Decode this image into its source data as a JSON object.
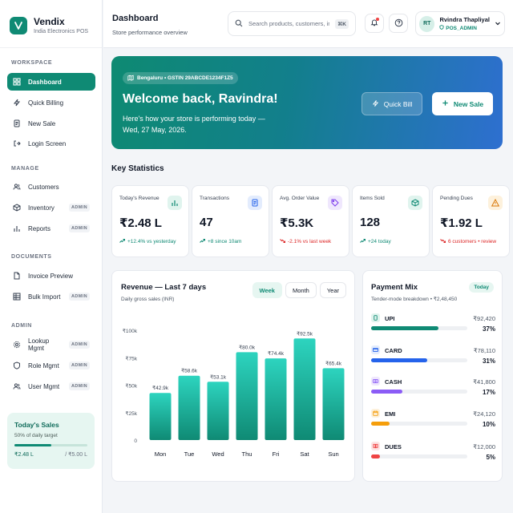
{
  "brand": {
    "name": "Vendix",
    "subtitle": "India Electronics POS"
  },
  "sidebar": {
    "sections": [
      {
        "label": "WORKSPACE",
        "items": [
          {
            "label": "Dashboard",
            "icon": "grid-icon",
            "active": true
          },
          {
            "label": "Quick Billing",
            "icon": "bolt-icon"
          },
          {
            "label": "New Sale",
            "icon": "receipt-icon"
          },
          {
            "label": "Login Screen",
            "icon": "login-icon"
          }
        ]
      },
      {
        "label": "MANAGE",
        "items": [
          {
            "label": "Customers",
            "icon": "users-icon"
          },
          {
            "label": "Inventory",
            "icon": "box-icon",
            "badge": "ADMIN"
          },
          {
            "label": "Reports",
            "icon": "bar-chart-icon",
            "badge": "ADMIN"
          }
        ]
      },
      {
        "label": "DOCUMENTS",
        "items": [
          {
            "label": "Invoice Preview",
            "icon": "file-icon"
          },
          {
            "label": "Bulk Import",
            "icon": "table-icon",
            "badge": "ADMIN"
          }
        ]
      },
      {
        "label": "ADMIN",
        "items": [
          {
            "label": "Lookup Mgmt",
            "icon": "gear-icon",
            "badge": "ADMIN"
          },
          {
            "label": "Role Mgmt",
            "icon": "shield-icon",
            "badge": "ADMIN"
          },
          {
            "label": "User Mgmt",
            "icon": "users-icon",
            "badge": "ADMIN"
          }
        ]
      }
    ],
    "sales_card": {
      "title": "Today's Sales",
      "subtitle": "50% of daily target",
      "progress": 0.5,
      "current": "₹2.48 L",
      "target": "/ ₹5.00 L"
    }
  },
  "header": {
    "title": "Dashboard",
    "subtitle": "Store performance overview",
    "search_placeholder": "Search products, customers, in",
    "shortcut": "⌘K",
    "user": {
      "initials": "RT",
      "name": "Rvindra Thapliyal",
      "role": "POS_ADMIN"
    }
  },
  "hero": {
    "pill": "Bengaluru • GSTIN 29ABCDE1234F1Z5",
    "title": "Welcome back, Ravindra!",
    "subtitle": "Here's how your store is performing today — Wed, 27 May, 2026.",
    "quick_bill": "Quick Bill",
    "new_sale": "New Sale"
  },
  "key_stats_title": "Key Statistics",
  "stats": [
    {
      "label": "Today's Revenue",
      "value": "₹2.48 L",
      "delta": "+12.4% vs yesterday",
      "trend": "up",
      "icon": "bar-chart-icon",
      "color": "#0f8a74",
      "bg": "#e0f4ee"
    },
    {
      "label": "Transactions",
      "value": "47",
      "delta": "+8 since 10am",
      "trend": "up",
      "icon": "receipt-icon",
      "color": "#2563eb",
      "bg": "#e3ecfd"
    },
    {
      "label": "Avg. Order Value",
      "value": "₹5.3K",
      "delta": "-2.1% vs last week",
      "trend": "down",
      "icon": "tag-icon",
      "color": "#7c3aed",
      "bg": "#efe7fd"
    },
    {
      "label": "Items Sold",
      "value": "128",
      "delta": "+24 today",
      "trend": "up",
      "icon": "box-icon",
      "color": "#0f8a74",
      "bg": "#e0f4ee"
    },
    {
      "label": "Pending Dues",
      "value": "₹1.92 L",
      "delta": "6 customers • review",
      "trend": "down",
      "icon": "warning-icon",
      "color": "#d97706",
      "bg": "#fdf1dc"
    }
  ],
  "revenue": {
    "title": "Revenue — Last 7 days",
    "subtitle": "Daily gross sales (INR)",
    "tabs": [
      "Week",
      "Month",
      "Year"
    ],
    "active_tab": "Week"
  },
  "chart_data": {
    "type": "bar",
    "title": "Revenue — Last 7 days",
    "categories": [
      "Mon",
      "Tue",
      "Wed",
      "Thu",
      "Fri",
      "Sat",
      "Sun"
    ],
    "values": [
      42.9,
      58.6,
      53.1,
      80.0,
      74.4,
      92.5,
      65.4
    ],
    "data_labels": [
      "₹42.9k",
      "₹58.6k",
      "₹53.1k",
      "₹80.0k",
      "₹74.4k",
      "₹92.5k",
      "₹65.4k"
    ],
    "y_ticks": [
      0,
      25,
      50,
      75,
      100
    ],
    "y_tick_labels": [
      "0",
      "₹25k",
      "₹50k",
      "₹75k",
      "₹100k"
    ],
    "ylim": [
      0,
      100
    ],
    "grid": false,
    "color": "#14b8a6"
  },
  "payment_mix": {
    "title": "Payment Mix",
    "badge": "Today",
    "subtitle": "Tender-mode breakdown • ₹2,48,450",
    "items": [
      {
        "name": "UPI",
        "amount": "₹92,420",
        "pct_label": "37%",
        "pct": 37,
        "color": "#0f8a74",
        "icon_bg": "#e0f4ee"
      },
      {
        "name": "CARD",
        "amount": "₹78,110",
        "pct_label": "31%",
        "pct": 31,
        "color": "#2563eb",
        "icon_bg": "#e3ecfd"
      },
      {
        "name": "CASH",
        "amount": "₹41,800",
        "pct_label": "17%",
        "pct": 17,
        "color": "#8b5cf6",
        "icon_bg": "#efe7fd"
      },
      {
        "name": "EMI",
        "amount": "₹24,120",
        "pct_label": "10%",
        "pct": 10,
        "color": "#f59e0b",
        "icon_bg": "#fdf1dc"
      },
      {
        "name": "DUES",
        "amount": "₹12,000",
        "pct_label": "5%",
        "pct": 5,
        "color": "#ef4444",
        "icon_bg": "#fde4e4"
      }
    ]
  }
}
